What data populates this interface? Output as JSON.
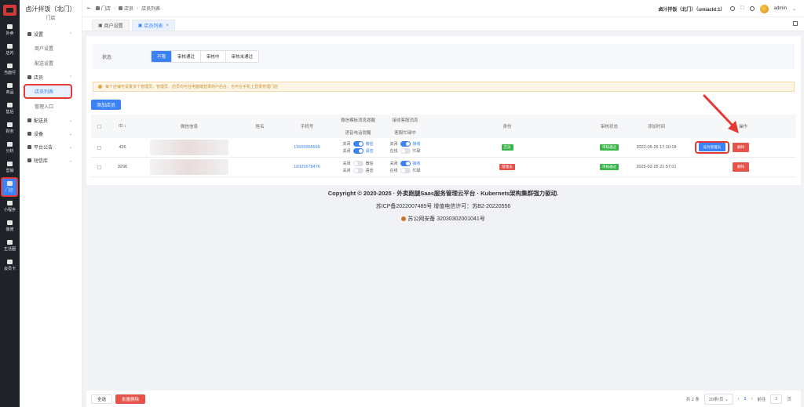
{
  "rail": {
    "items": [
      {
        "label": "外卖",
        "active": false
      },
      {
        "label": "店内",
        "active": false
      },
      {
        "label": "当面付",
        "active": false
      },
      {
        "label": "商品",
        "active": false
      },
      {
        "label": "售后",
        "active": false
      },
      {
        "label": "财务",
        "active": false
      },
      {
        "label": "分析",
        "active": false
      },
      {
        "label": "营销",
        "active": false
      },
      {
        "label": "门店",
        "active": true
      },
      {
        "label": "小程序",
        "active": false
      },
      {
        "label": "装修",
        "active": false
      },
      {
        "label": "生活圈",
        "active": false
      },
      {
        "label": "会员卡",
        "active": false
      }
    ]
  },
  "submenu": {
    "shop_name": "卤汁拌饭（北门）",
    "shop_sub": "门店",
    "groups": [
      {
        "label": "设置",
        "chev": "⌃",
        "items": [
          "商户设置",
          "配送设置"
        ]
      },
      {
        "label": "店员",
        "chev": "⌃",
        "items": [
          "店员列表",
          "管理入口"
        ]
      },
      {
        "label": "配送员",
        "chev": "⌄",
        "items": []
      },
      {
        "label": "设备",
        "chev": "⌄",
        "items": []
      },
      {
        "label": "平台公告",
        "chev": "⌄",
        "items": []
      },
      {
        "label": "短信库",
        "chev": "⌄",
        "items": []
      }
    ]
  },
  "topbar": {
    "crumbs": [
      "门店",
      "店员",
      "店员列表"
    ],
    "shop_info": "卤汁拌饭（北门）（umiacId:1）",
    "user": "admin"
  },
  "tabs": [
    {
      "label": "商户设置",
      "active": false
    },
    {
      "label": "店员列表",
      "active": true,
      "close": "×"
    }
  ],
  "filter": {
    "label": "状态",
    "options": [
      {
        "label": "不限",
        "on": true
      },
      {
        "label": "审核通过",
        "on": false
      },
      {
        "label": "审核中",
        "on": false
      },
      {
        "label": "审核未通过",
        "on": false
      }
    ]
  },
  "notice": "每个店铺可设置多个管理员，管理员、店员均可在电脑端登录商户后台，也可在手机上登录管理门店",
  "add_button": "添加店员",
  "table": {
    "headers": {
      "id": "ID ↕",
      "wechat": "微信信息",
      "name": "姓名",
      "phone": "手机号",
      "notify1": "微信模板消息提醒",
      "notify2": "语音电话提醒",
      "service1": "接收客服消息",
      "service2": "客服忙碌中",
      "identity": "身份",
      "status": "审核状态",
      "added": "添加时间",
      "action": "操作"
    },
    "rows": [
      {
        "id": "426",
        "phone": "15555555555",
        "n1_off": "关闭",
        "n1_on": "微信",
        "n1_state": true,
        "n2_off": "关闭",
        "n2_on": "语音",
        "n2_state": true,
        "s1_off": "关闭",
        "s1_on": "接收",
        "s1_state": true,
        "s2_off": "在线",
        "s2_on": "忙碌",
        "s2_state": false,
        "identity": "店员",
        "identity_color": "g",
        "status": "审核通过",
        "added": "2022-05-26 17:10:18",
        "btn_primary": "设为管理员",
        "btn_delete": "删除"
      },
      {
        "id": "9296",
        "phone": "18325578476",
        "n1_off": "关闭",
        "n1_on": "微信",
        "n1_state": false,
        "n2_off": "关闭",
        "n2_on": "语音",
        "n2_state": false,
        "s1_off": "关闭",
        "s1_on": "接收",
        "s1_state": true,
        "s2_off": "在线",
        "s2_on": "忙碌",
        "s2_state": false,
        "identity": "管理员",
        "identity_color": "r",
        "status": "审核通过",
        "added": "2025-02-25 21:57:01",
        "btn_delete": "删除"
      }
    ]
  },
  "copyright": {
    "line1": "Copyright © 2020-2025 · 外卖跑腿Saas服务管理云平台 · Kubernets架构集群强力驱动.",
    "line2": "苏ICP备2022007489号    增值电信许可：苏B2-20220556",
    "line3": "苏公网安备 32030302001041号"
  },
  "footer": {
    "select_all": "全选",
    "batch_delete": "批量删除",
    "total": "共 2 条",
    "page_size": "20条/页",
    "current_page": "1",
    "goto_label": "前往",
    "goto_value": "1",
    "page_unit": "页"
  },
  "colors": {
    "accent": "#3b82f6",
    "danger": "#e5534b",
    "success": "#3bb54a",
    "highlight": "#e53935"
  }
}
